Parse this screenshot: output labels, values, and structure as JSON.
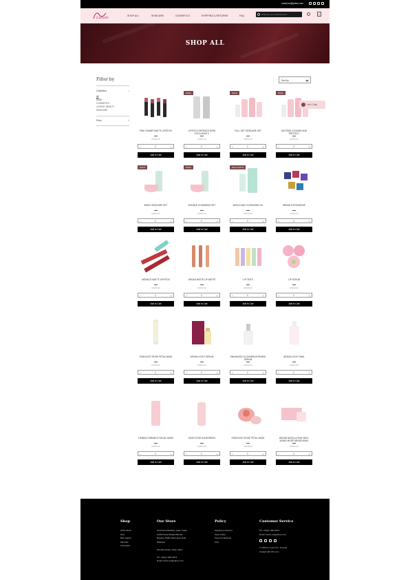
{
  "topbar": {
    "email": "lucent.co@yahoo.com"
  },
  "header": {
    "logo_text": "Lucent",
    "nav": [
      "SHOP ALL",
      "SKINCARE",
      "COSMETICS",
      "SHIPPING & RETURNS",
      "FAQ"
    ],
    "search_placeholder": "What are you searching for?",
    "cart_count": "0"
  },
  "hero": {
    "title": "SHOP ALL"
  },
  "filter": {
    "title": "Filter by",
    "collection_label": "Collection",
    "collections": [
      "All",
      "BABE",
      "COSMETICS",
      "LUCENT BEAUTY",
      "SKINCARE"
    ],
    "price_label": "Price"
  },
  "sort": {
    "label": "Sort by"
  },
  "chat": {
    "label": "Let's Chat!"
  },
  "products": [
    {
      "name": "PINK GUMMY MATTE LIPSTICK",
      "price": "RM30.00",
      "badge": "",
      "qty": "1",
      "add": "Add to Cart",
      "art": "lipsticks"
    },
    {
      "name": "LIPSTICK DEFENCE BYRE EXCLUSIVE 2",
      "price": "RM80.00",
      "badge": "SALE",
      "qty": "1",
      "add": "Add to Cart",
      "art": "silver"
    },
    {
      "name": "FULL SET SKINCARE SET",
      "price": "RM90.00",
      "badge": "SALE",
      "qty": "1",
      "add": "Add to Cart",
      "art": "pinkset"
    },
    {
      "name": "DAYTIME CLEANSE AND PROTECT",
      "price": "RM65.00",
      "badge": "SALE",
      "qty": "1",
      "add": "Add to Cart",
      "art": "pinkset"
    },
    {
      "name": "BASIC SKINCARE SET",
      "price": "RM69.00",
      "badge": "SALE",
      "qty": "1",
      "add": "Add to Cart",
      "art": "tubejar"
    },
    {
      "name": "DOUBLE CLEANSING SET",
      "price": "RM55.00",
      "badge": "SALE",
      "qty": "1",
      "add": "Add to Cart",
      "art": "tubejar"
    },
    {
      "name": "WISH A WAY CLEANSING OIL",
      "price": "RM40.00",
      "badge": "New Product",
      "qty": "1",
      "add": "Add to Cart",
      "art": "mint"
    },
    {
      "name": "ARDAN EYESHADOW",
      "price": "RM45.00",
      "badge": "",
      "qty": "1",
      "add": "Add to Cart",
      "art": "palette"
    },
    {
      "name": "MONACO MATTE LIPSTICK",
      "price": "RM28.00",
      "badge": "",
      "qty": "1",
      "add": "Add to Cart",
      "art": "redlip"
    },
    {
      "name": "ARGAN MATTE LIP MATTE",
      "price": "RM25.00",
      "badge": "",
      "qty": "1",
      "add": "Add to Cart",
      "art": "gloss"
    },
    {
      "name": "LIP TINTS",
      "price": "RM38.00",
      "badge": "",
      "qty": "1",
      "add": "Add to Cart",
      "art": "tints"
    },
    {
      "name": "LIP SCRUB",
      "price": "RM20.00",
      "badge": "",
      "qty": "1",
      "add": "Add to Cart",
      "art": "balls"
    },
    {
      "name": "STARLIGHT ROSE PETAL MASK",
      "price": "RM45.00",
      "badge": "",
      "qty": "1",
      "add": "Add to Cart",
      "art": "tube"
    },
    {
      "name": "ARGAN LIGHT SERUM",
      "price": "RM80.00",
      "badge": "",
      "qty": "1",
      "add": "Add to Cart",
      "art": "boxbottle"
    },
    {
      "name": "ENHANCED GLOW BRIGHTENING SERUM",
      "price": "RM65.00",
      "badge": "",
      "qty": "1",
      "add": "Add to Cart",
      "art": "dropper"
    },
    {
      "name": "ARGAN LIGHT 15ML",
      "price": "RM65.00",
      "badge": "",
      "qty": "1",
      "add": "Add to Cart",
      "art": "pump"
    },
    {
      "name": "TWINKLE WRINKLE FACIAL MASK",
      "price": "RM55.00",
      "badge": "",
      "qty": "1",
      "add": "Add to Cart",
      "art": "pinktube"
    },
    {
      "name": "DASH STAR SUNSCREEN",
      "price": "RM30.00",
      "badge": "",
      "qty": "1",
      "add": "Add to Cart",
      "art": "pinktube2"
    },
    {
      "name": "STARLIGHT ROSE PETAL MASK",
      "price": "RM45.00",
      "badge": "",
      "qty": "1",
      "add": "Add to Cart",
      "art": "jars"
    },
    {
      "name": "ARGAN NIGELLA PINK WELL AGING MOISTURIZER 50ML",
      "price": "RM80.00",
      "badge": "",
      "qty": "1",
      "add": "Add to Cart",
      "art": "box"
    }
  ],
  "footer": {
    "shop": {
      "title": "Shop",
      "items": [
        "All Products",
        "New",
        "Best Sellers",
        "Skincare",
        "Cosmetics"
      ]
    },
    "store": {
      "title": "Our Store",
      "lines": [
        "1010 Suria Building, Jalan Kuala",
        "Pj 800 Suria Melaka Bandar",
        "Building 75000 Shah Alam DOK",
        "Malaysia",
        "",
        "Monday-Friday: 10am-10pm",
        "",
        "Tel: +60(1) 1992 9674",
        "Email: lucent.co@yahoo.com"
      ]
    },
    "policy": {
      "title": "Policy",
      "items": [
        "Shipping & Returns",
        "Store Policy",
        "Payment Methods",
        "FAQ"
      ]
    },
    "service": {
      "title": "Customer Service",
      "lines": [
        "Tel: +60(1) 1992 9674",
        "Email: lucent.co@yahoo.com"
      ],
      "copyright": [
        "© 2023 by Lucent Co. Proudly",
        "created with Wix.com"
      ]
    }
  },
  "colors": {
    "header_bg": "#fbe6e9",
    "hero_bg": "#4a1217",
    "badge": "#7b4a4e",
    "footer_bg": "#000000"
  }
}
